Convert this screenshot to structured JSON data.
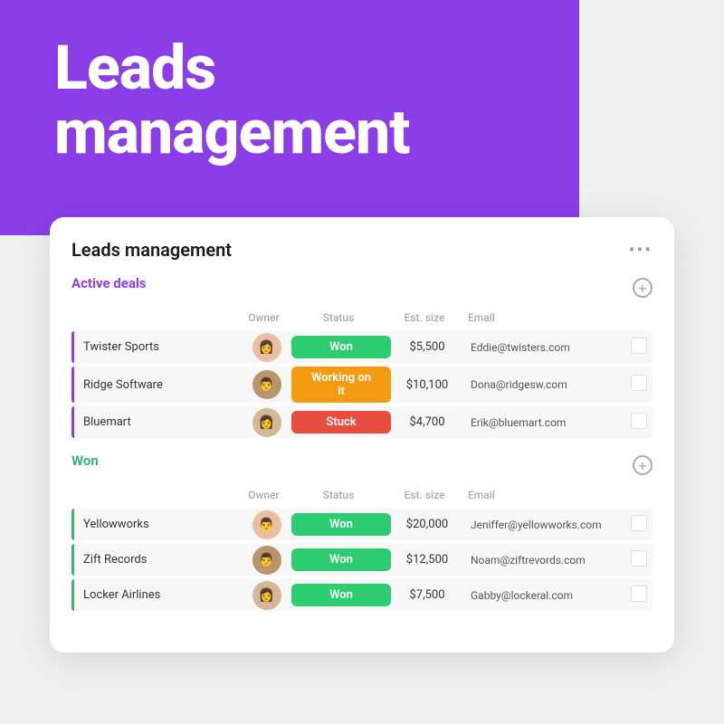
{
  "hero": {
    "title_line1": "Leads",
    "title_line2": "management"
  },
  "card": {
    "title": "Leads management",
    "more_icon": "•••",
    "active_section": {
      "label": "Active deals",
      "columns": {
        "owner": "Owner",
        "status": "Status",
        "est_size": "Est. size",
        "email": "Email"
      },
      "deals": [
        {
          "name": "Twister Sports",
          "owner_initials": "👩",
          "status": "Won",
          "status_type": "won",
          "est_size": "$5,500",
          "email": "Eddie@twisters.com"
        },
        {
          "name": "Ridge Software",
          "owner_initials": "👨",
          "status": "Working on it",
          "status_type": "working",
          "est_size": "$10,100",
          "email": "Dona@ridgesw.com"
        },
        {
          "name": "Bluemart",
          "owner_initials": "👩",
          "status": "Stuck",
          "status_type": "stuck",
          "est_size": "$4,700",
          "email": "Erik@bluemart.com"
        }
      ]
    },
    "won_section": {
      "label": "Won",
      "columns": {
        "owner": "Owner",
        "status": "Status",
        "est_size": "Est. size",
        "email": "Email"
      },
      "deals": [
        {
          "name": "Yellowworks",
          "owner_initials": "👨",
          "status": "Won",
          "status_type": "won",
          "est_size": "$20,000",
          "email": "Jeniffer@yellowworks.com"
        },
        {
          "name": "Zift Records",
          "owner_initials": "👨",
          "status": "Won",
          "status_type": "won",
          "est_size": "$12,500",
          "email": "Noam@ziftrevords.com"
        },
        {
          "name": "Locker Airlines",
          "owner_initials": "👩",
          "status": "Won",
          "status_type": "won",
          "est_size": "$7,500",
          "email": "Gabby@lockeral.com"
        }
      ]
    }
  }
}
